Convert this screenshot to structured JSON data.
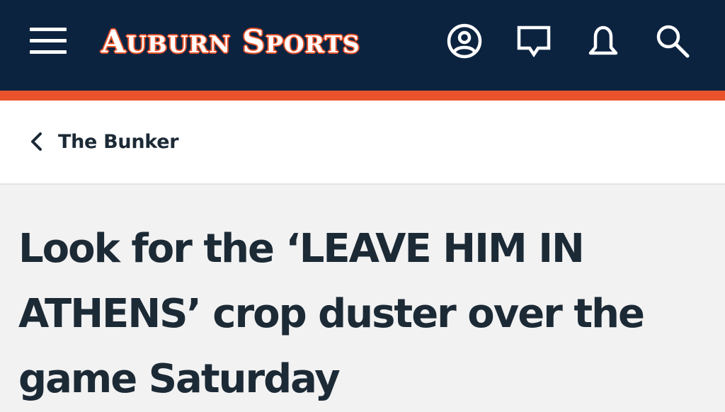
{
  "header": {
    "brand_word_1_initial": "A",
    "brand_word_1_rest": "UBURN",
    "brand_word_2_initial": "S",
    "brand_word_2_rest": "PORTS",
    "icons": [
      "menu-icon",
      "account-icon",
      "chat-icon",
      "bell-icon",
      "search-icon"
    ],
    "colors": {
      "navy": "#0c2340",
      "orange": "#e8532b",
      "text_dark": "#1c2a36"
    }
  },
  "breadcrumb": {
    "back_label": "The Bunker",
    "icon": "chevron-left-icon"
  },
  "article": {
    "headline": "Look for the ‘LEAVE HIM IN ATHENS’ crop duster over the game Saturday"
  }
}
